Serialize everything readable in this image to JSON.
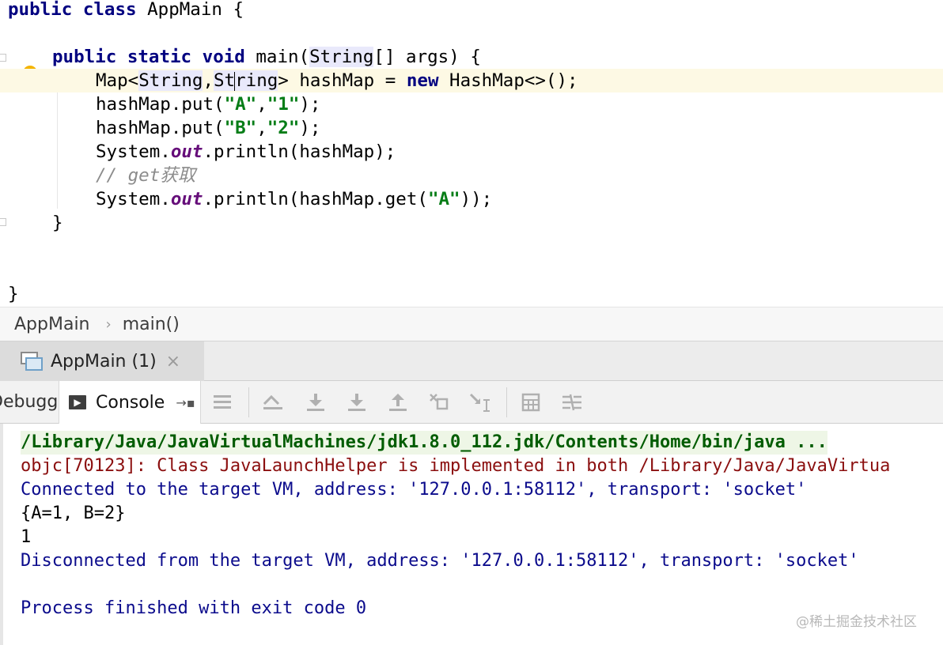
{
  "editor": {
    "l1_kw": "public class",
    "l1_rest": " AppMain {",
    "l2_kw": "public static void",
    "l2_a": " main(",
    "l2_string": "String",
    "l2_b": "[] args) {",
    "l3_a": "Map<",
    "l3_string1": "String",
    "l3_comma": ",",
    "l3_st": "St",
    "l3_ring": "ring",
    "l3_b": "> hashMap = ",
    "l3_new": "new",
    "l3_c": " HashMap<>();",
    "l4_a": "hashMap.put(",
    "l4_s1": "\"A\"",
    "l4_comma": ",",
    "l4_s2": "\"1\"",
    "l4_b": ");",
    "l5_a": "hashMap.put(",
    "l5_s1": "\"B\"",
    "l5_comma": ",",
    "l5_s2": "\"2\"",
    "l5_b": ");",
    "l6_a": "System.",
    "l6_out": "out",
    "l6_b": ".println(hashMap);",
    "l7_comment": "// get获取",
    "l8_a": "System.",
    "l8_out": "out",
    "l8_b": ".println(hashMap.get(",
    "l8_s": "\"A\"",
    "l8_c": "));",
    "l9": "}",
    "l10": "}"
  },
  "breadcrumb": {
    "class": "AppMain",
    "separator": "›",
    "method": "main()"
  },
  "run_tab": {
    "label": "AppMain (1)",
    "close": "×"
  },
  "toolbar": {
    "debugger_label": "Debugger",
    "console_label": "Console",
    "console_icon_glyph": "▶",
    "pin_glyph": "→▪",
    "icons": [
      "menu-icon",
      "show-execution-point-icon",
      "step-over-icon",
      "step-into-icon",
      "step-out-icon",
      "run-to-cursor-icon",
      "evaluate-expression-icon",
      "calculator-icon",
      "trace-icon"
    ]
  },
  "console": {
    "line1": "/Library/Java/JavaVirtualMachines/jdk1.8.0_112.jdk/Contents/Home/bin/java ...",
    "line2": "objc[70123]: Class JavaLaunchHelper is implemented in both /Library/Java/JavaVirtua",
    "line3": "Connected to the target VM, address: '127.0.0.1:58112', transport: 'socket'",
    "line4": "{A=1, B=2}",
    "line5": "1",
    "line6": "Disconnected from the target VM, address: '127.0.0.1:58112', transport: 'socket'",
    "line7": "Process finished with exit code 0"
  },
  "watermark": "@稀土掘金技术社区",
  "colors": {
    "keyword": "#000080",
    "string": "#067d17",
    "static_field": "#660e7a",
    "comment": "#8c8c8c",
    "console_error": "#8b0f0f",
    "console_system": "#0b0b8c",
    "console_command": "#005c00"
  }
}
